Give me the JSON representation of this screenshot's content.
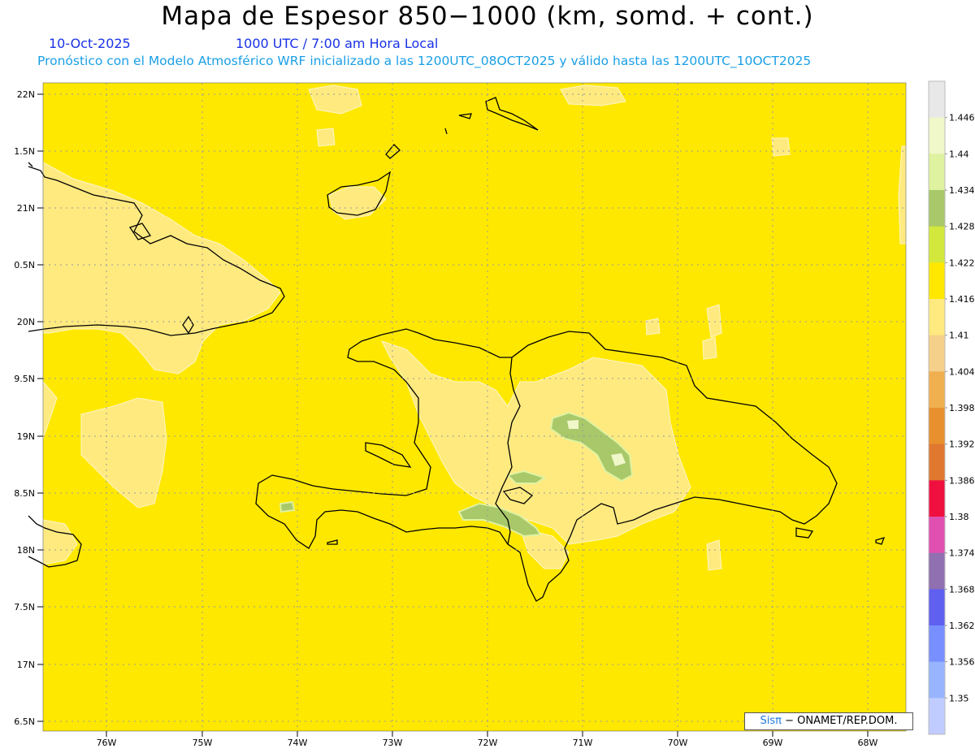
{
  "header": {
    "title": "Mapa de Espesor 850−1000 (km, somd. + cont.)",
    "date": "10-Oct-2025",
    "valid_time": "1000 UTC / 7:00 am Hora Local",
    "description": "Pronóstico con el Modelo Atmosférico WRF inicializado a las 1200UTC_08OCT2025 y válido hasta las  1200UTC_10OCT2025"
  },
  "map": {
    "lat_labels": [
      "22N",
      "1.5N",
      "21N",
      "0.5N",
      "20N",
      "9.5N",
      "19N",
      "8.5N",
      "18N",
      "7.5N",
      "17N",
      "6.5N"
    ],
    "lon_labels": [
      "76W",
      "75W",
      "74W",
      "73W",
      "72W",
      "71W",
      "70W",
      "69W",
      "68W"
    ],
    "background_color": "#ffe800"
  },
  "colorbar": {
    "labels": [
      "1.446",
      "1.44",
      "1.434",
      "1.428",
      "1.422",
      "1.416",
      "1.41",
      "1.404",
      "1.398",
      "1.392",
      "1.386",
      "1.38",
      "1.374",
      "1.368",
      "1.362",
      "1.356",
      "1.35"
    ],
    "colors": [
      "#e8e8e8",
      "#f0f7c8",
      "#dff2a0",
      "#a8c86a",
      "#d2e83c",
      "#ffe800",
      "#ffea80",
      "#f5d08a",
      "#f0b050",
      "#e8902e",
      "#e07830",
      "#f01040",
      "#e050b0",
      "#9070b0",
      "#6060f0",
      "#7890ff",
      "#98b4ff",
      "#c0ccff"
    ]
  },
  "credit": {
    "brand": "Sisπ",
    "text": " − ONAMET/REP.DOM."
  }
}
